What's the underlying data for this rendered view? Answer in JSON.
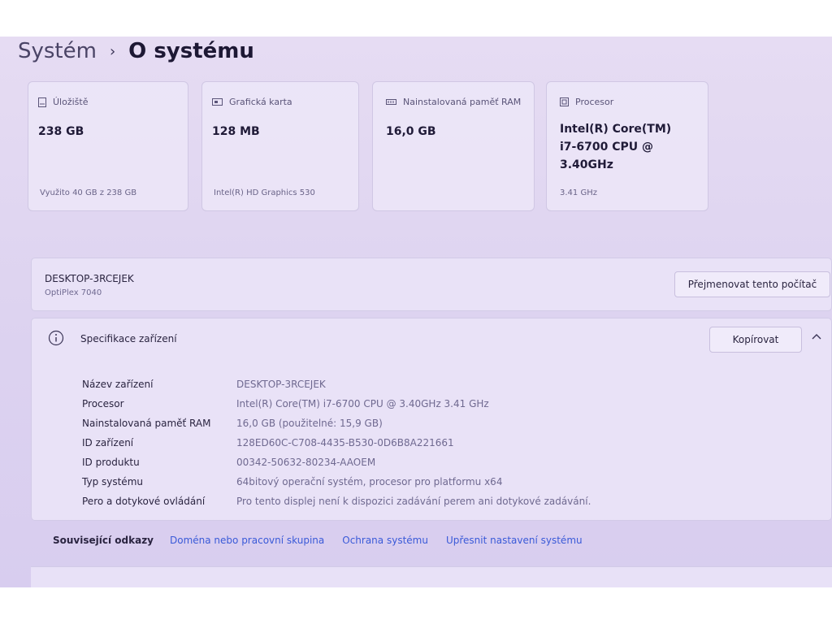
{
  "breadcrumb": {
    "parent": "Systém",
    "separator": "›",
    "current": "O systému"
  },
  "cards": [
    {
      "icon": "storage-icon",
      "label": "Úložiště",
      "value": "238 GB",
      "sub": "Využito 40 GB z 238 GB"
    },
    {
      "icon": "graphics-card-icon",
      "label": "Grafická karta",
      "value": "128 MB",
      "sub": "Intel(R) HD Graphics 530"
    },
    {
      "icon": "ram-icon",
      "label": "Nainstalovaná paměť RAM",
      "value": "16,0 GB",
      "sub": ""
    },
    {
      "icon": "processor-icon",
      "label": "Procesor",
      "value_lines": [
        "Intel(R) Core(TM)",
        "i7-6700 CPU @",
        "3.40GHz"
      ],
      "sub": "3.41 GHz"
    }
  ],
  "device": {
    "name": "DESKTOP-3RCEJEK",
    "model": "OptiPlex 7040",
    "rename_label": "Přejmenovat tento počítač"
  },
  "spec": {
    "title": "Specifikace zařízení",
    "copy_label": "Kopírovat",
    "rows": [
      {
        "label": "Název zařízení",
        "value": "DESKTOP-3RCEJEK"
      },
      {
        "label": "Procesor",
        "value": "Intel(R) Core(TM) i7-6700 CPU @ 3.40GHz   3.41 GHz"
      },
      {
        "label": "Nainstalovaná paměť RAM",
        "value": "16,0 GB (použitelné: 15,9 GB)"
      },
      {
        "label": "ID zařízení",
        "value": "128ED60C-C708-4435-B530-0D6B8A221661"
      },
      {
        "label": "ID produktu",
        "value": "00342-50632-80234-AAOEM"
      },
      {
        "label": "Typ systému",
        "value": "64bitový operační systém, procesor pro platformu x64"
      },
      {
        "label": "Pero a dotykové ovládání",
        "value": "Pro tento displej není k dispozici zadávání perem ani dotykové zadávání."
      }
    ]
  },
  "related": {
    "title": "Související odkazy",
    "links": [
      "Doména nebo pracovní skupina",
      "Ochrana systému",
      "Upřesnit nastavení systému"
    ]
  },
  "colors": {
    "accent_link": "#3a5ad8",
    "background": "#ddd3f0"
  }
}
